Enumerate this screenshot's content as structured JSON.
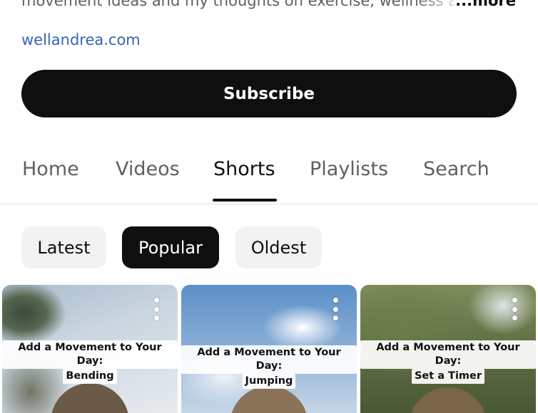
{
  "channel": {
    "description": "movement ideas and my thoughts on exercise, wellness and th",
    "more_label": "...more",
    "link": "wellandrea.com",
    "subscribe_label": "Subscribe"
  },
  "tabs": [
    {
      "label": "Home",
      "active": false
    },
    {
      "label": "Videos",
      "active": false
    },
    {
      "label": "Shorts",
      "active": true
    },
    {
      "label": "Playlists",
      "active": false
    },
    {
      "label": "Search",
      "active": false
    }
  ],
  "filters": [
    {
      "label": "Latest",
      "selected": false
    },
    {
      "label": "Popular",
      "selected": true
    },
    {
      "label": "Oldest",
      "selected": false
    }
  ],
  "shorts": [
    {
      "caption_line1": "Add a Movement to Your Day:",
      "caption_line2": "Bending"
    },
    {
      "caption_line1": "Add a Movement to Your Day:",
      "caption_line2": "Jumping"
    },
    {
      "caption_line1": "Add a Movement to Your Day:",
      "caption_line2": "Set a Timer"
    }
  ],
  "colors": {
    "link": "#3366b5",
    "primary": "#0f0f0f",
    "chip_bg": "#f2f2f2",
    "muted_text": "#606060"
  }
}
